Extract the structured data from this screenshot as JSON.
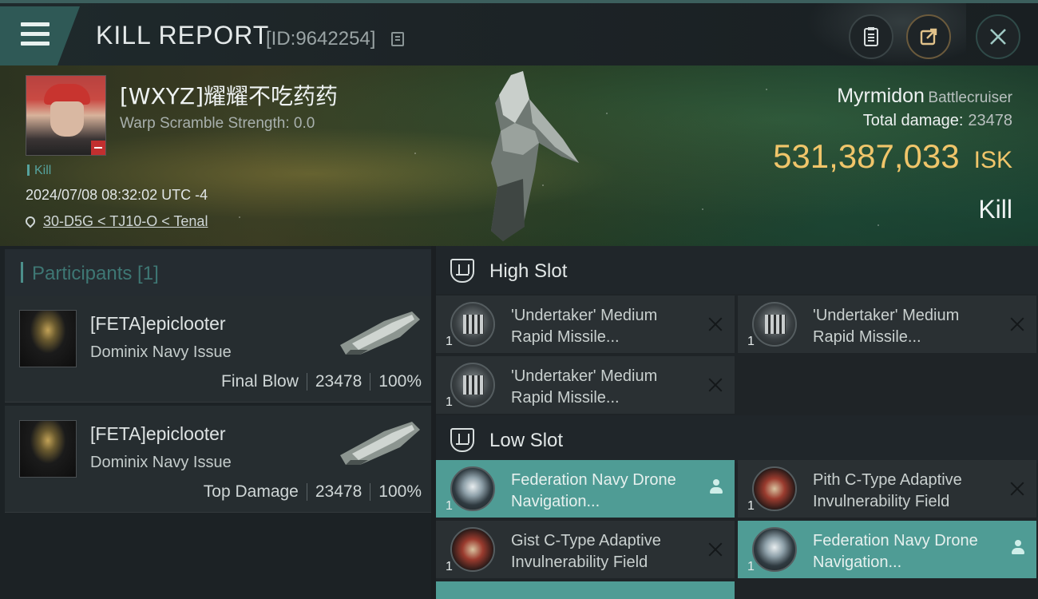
{
  "header": {
    "title": "KILL REPORT",
    "kill_id": "[ID:9642254]"
  },
  "victim": {
    "name": "[WXYZ]耀耀不吃药药",
    "warp_scramble": "Warp Scramble Strength: 0.0",
    "tag": "Kill",
    "timestamp": "2024/07/08 08:32:02 UTC -4",
    "location": "30-D5G < TJ10-O < Tenal"
  },
  "ship": {
    "name": "Myrmidon",
    "class": "Battlecruiser",
    "total_damage_label": "Total damage:",
    "total_damage": "23478",
    "isk_value": "531,387,033",
    "currency": "ISK",
    "result": "Kill"
  },
  "participants": {
    "label": "Participants [1]",
    "rows": [
      {
        "name": "[FETA]epiclooter",
        "ship": "Dominix Navy Issue",
        "role": "Final Blow",
        "damage": "23478",
        "percent": "100%"
      },
      {
        "name": "[FETA]epiclooter",
        "ship": "Dominix Navy Issue",
        "role": "Top Damage",
        "damage": "23478",
        "percent": "100%"
      }
    ]
  },
  "slots": {
    "high": {
      "label": "High Slot",
      "items": [
        {
          "qty": "1",
          "name": "'Undertaker' Medium Rapid Missile...",
          "icon": "missile-launcher-icon"
        },
        {
          "qty": "1",
          "name": "'Undertaker' Medium Rapid Missile...",
          "icon": "missile-launcher-icon"
        },
        {
          "qty": "1",
          "name": "'Undertaker' Medium Rapid Missile...",
          "icon": "missile-launcher-icon"
        }
      ]
    },
    "low": {
      "label": "Low Slot",
      "items": [
        {
          "qty": "1",
          "name": "Federation Navy Drone Navigation...",
          "icon": "drone-navigation-icon",
          "state": "dropped"
        },
        {
          "qty": "1",
          "name": "Pith C-Type Adaptive Invulnerability Field",
          "icon": "shield-field-icon",
          "state": "destroyed"
        },
        {
          "qty": "1",
          "name": "Gist C-Type Adaptive Invulnerability Field",
          "icon": "shield-field-icon",
          "state": "destroyed"
        },
        {
          "qty": "1",
          "name": "Federation Navy Drone Navigation...",
          "icon": "drone-navigation-icon",
          "state": "dropped"
        }
      ]
    }
  },
  "colors": {
    "accent_teal": "#4f9c95",
    "isk_gold": "#f0c56a",
    "background": "#1b1f22"
  }
}
